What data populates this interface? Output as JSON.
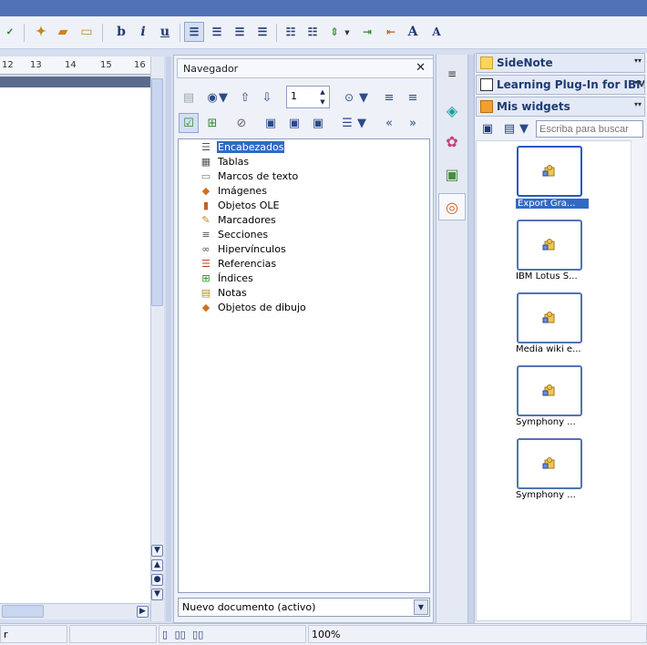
{
  "toolbar": {
    "items": [
      "b",
      "i",
      "u",
      "A",
      "A"
    ]
  },
  "ruler": {
    "ticks": [
      "12",
      "13",
      "14",
      "15",
      "16"
    ]
  },
  "navigator": {
    "title": "Navegador",
    "close_glyph": "✕",
    "page_number": "1",
    "tree": [
      {
        "label": "Encabezados",
        "icon": "headings-icon",
        "selected": true
      },
      {
        "label": "Tablas",
        "icon": "tables-icon"
      },
      {
        "label": "Marcos de texto",
        "icon": "text-frames-icon"
      },
      {
        "label": "Imágenes",
        "icon": "images-icon"
      },
      {
        "label": "Objetos OLE",
        "icon": "ole-objects-icon"
      },
      {
        "label": "Marcadores",
        "icon": "bookmarks-icon"
      },
      {
        "label": "Secciones",
        "icon": "sections-icon"
      },
      {
        "label": "Hipervínculos",
        "icon": "hyperlinks-icon"
      },
      {
        "label": "Referencias",
        "icon": "references-icon"
      },
      {
        "label": "Índices",
        "icon": "indexes-icon"
      },
      {
        "label": "Notas",
        "icon": "notes-icon"
      },
      {
        "label": "Objetos de dibujo",
        "icon": "drawing-objects-icon"
      }
    ],
    "document_select": "Nuevo documento (activo)"
  },
  "right_panel": {
    "sidenote": "SideNote",
    "learning": "Learning Plug-In for IBM...",
    "widgets_title": "Mis widgets",
    "search_placeholder": "Escriba para buscar",
    "widgets": [
      {
        "label": "Export Gra...",
        "selected": true
      },
      {
        "label": "IBM Lotus S..."
      },
      {
        "label": "Media wiki e..."
      },
      {
        "label": "Symphony ..."
      },
      {
        "label": "Symphony ..."
      }
    ]
  },
  "status": {
    "left_text": "r",
    "zoom": "100%"
  },
  "colors": {
    "title_bar": "#4f73b5",
    "selection": "#316ac5",
    "accent": "#1f3b73"
  }
}
